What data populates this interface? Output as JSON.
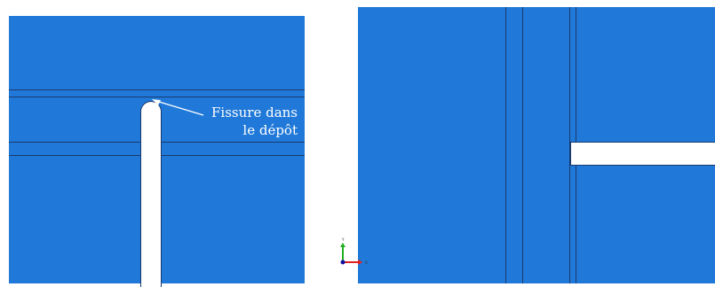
{
  "annotation": {
    "line1": "Fissure dans",
    "line2": "le dépôt"
  },
  "colors": {
    "mesh": "#2079d8",
    "line": "#1a3a6e",
    "slot": "#ffffff",
    "x_axis": "#e02020",
    "y_axis": "#20b020",
    "z_axis": "#1010a0"
  },
  "triad": {
    "y_label": "Y",
    "x_label": "X"
  }
}
